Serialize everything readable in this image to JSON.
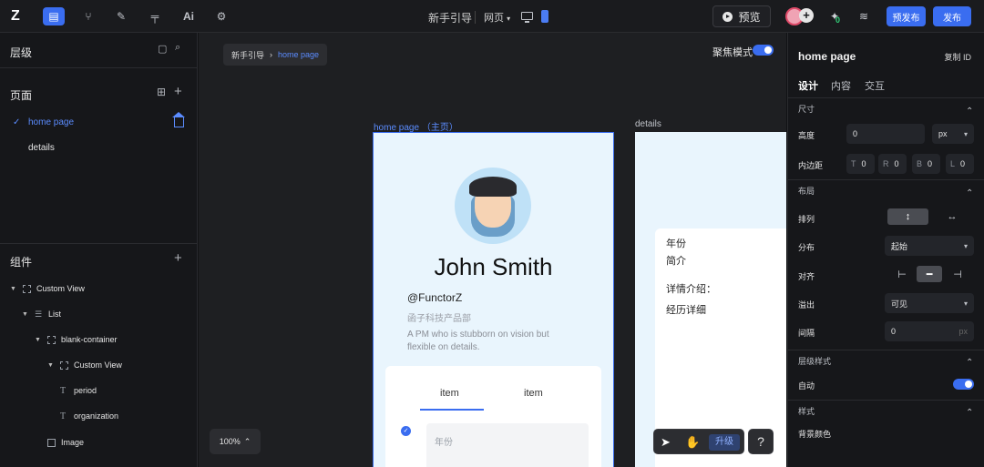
{
  "topbar": {
    "logo_icon": "functorz-logo",
    "project_title": "新手引导",
    "page_type": "网页",
    "preview_label": "预览",
    "badge_count": "0",
    "pre_publish_label": "预发布",
    "publish_label": "发布",
    "accent_color": "#3a6df0"
  },
  "left": {
    "layers_title": "层级",
    "pages_title": "页面",
    "pages": [
      {
        "name": "home page",
        "selected": true
      },
      {
        "name": "details",
        "selected": false
      }
    ],
    "components_title": "组件",
    "tree": [
      {
        "label": "Custom View",
        "icon": "view"
      },
      {
        "label": "List",
        "icon": "list"
      },
      {
        "label": "blank-container",
        "icon": "view"
      },
      {
        "label": "Custom View",
        "icon": "view"
      },
      {
        "label": "period",
        "icon": "text"
      },
      {
        "label": "organization",
        "icon": "text"
      },
      {
        "label": "Image",
        "icon": "image"
      }
    ]
  },
  "canvas": {
    "breadcrumb_root": "新手引导",
    "breadcrumb_current": "home page",
    "focus_mode_label": "聚焦模式",
    "frame1_label": "home page （主页）",
    "frame2_label": "details",
    "profile_name": "John Smith",
    "profile_handle": "@FunctorZ",
    "profile_org": "函子科技产品部",
    "profile_bio": "A PM who is stubborn on vision but flexible on details.",
    "tab1": "item",
    "tab2": "item",
    "input_placeholder": "年份",
    "details_lines": [
      "年份",
      "简介",
      "详情介绍：",
      "经历详细"
    ],
    "zoom_level": "100%",
    "upgrade_label": "升级",
    "help_label": "?"
  },
  "right": {
    "title": "home page",
    "copy_id_label": "复制 ID",
    "tabs": [
      "设计",
      "内容",
      "交互"
    ],
    "size_section": "尺寸",
    "height_label": "高度",
    "height_value": "0",
    "height_unit": "px",
    "padding_label": "内边距",
    "padding": [
      {
        "side": "T",
        "value": "0"
      },
      {
        "side": "R",
        "value": "0"
      },
      {
        "side": "B",
        "value": "0"
      },
      {
        "side": "L",
        "value": "0"
      }
    ],
    "layout_section": "布局",
    "arrange_label": "排列",
    "distribute_label": "分布",
    "distribute_value": "起始",
    "align_label": "对齐",
    "overflow_label": "溢出",
    "overflow_value": "可见",
    "gap_label": "间隔",
    "gap_value": "0",
    "gap_unit": "px",
    "layer_style_section": "层级样式",
    "auto_label": "自动",
    "style_section": "样式",
    "bg_color_label": "背景颜色"
  }
}
